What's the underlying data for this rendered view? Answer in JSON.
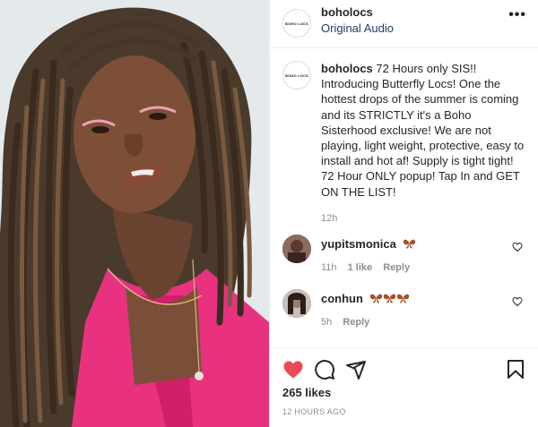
{
  "post": {
    "username": "boholocs",
    "audio": "Original Audio",
    "more_label": "•••",
    "logo_text": "BOHO LOCS"
  },
  "caption": {
    "username": "boholocs",
    "text": " 72 Hours only SIS!! Introducing Butterfly Locs! One the hottest drops of the summer is coming and its STRICTLY it's a Boho Sisterhood exclusive! We are not playing, light weight, protective, easy to install and hot af! Supply is tight tight! 72 Hour ONLY popup! Tap In and GET ON THE LIST!",
    "time": "12h"
  },
  "comments": [
    {
      "username": "yupitsmonica",
      "emoji_count": 1,
      "time": "11h",
      "likes": "1 like",
      "reply": "Reply"
    },
    {
      "username": "conhun",
      "emoji_count": 3,
      "time": "5h",
      "likes": "",
      "reply": "Reply"
    }
  ],
  "footer": {
    "likes": "265 likes",
    "time": "12 HOURS AGO"
  },
  "colors": {
    "like_red": "#ed4956",
    "link_blue": "#1f3b66",
    "muted": "#8e8e8e",
    "butterfly": "#a5522a"
  },
  "icons": [
    "heart-filled-icon",
    "comment-icon",
    "share-icon",
    "bookmark-icon",
    "small-heart-icon",
    "butterfly-emoji",
    "more-icon"
  ]
}
